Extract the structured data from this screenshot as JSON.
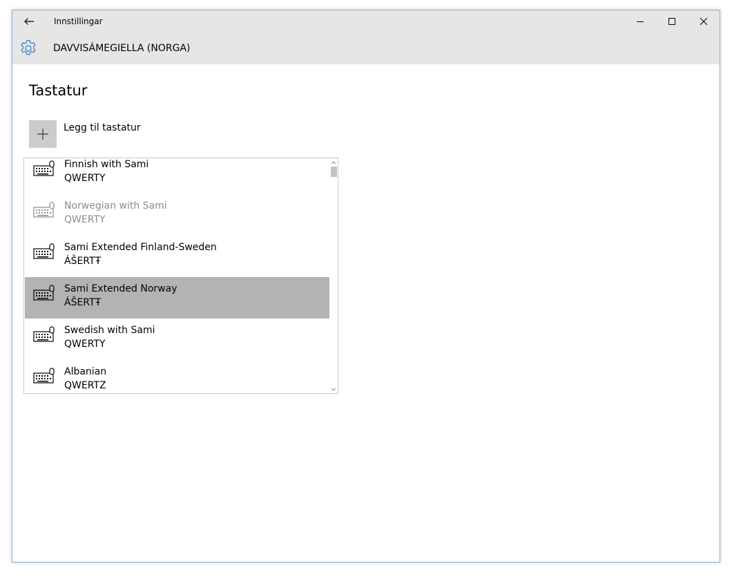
{
  "window": {
    "app_title": "Innstillingar",
    "controls": {
      "minimize_icon": "minimize-icon",
      "maximize_icon": "maximize-icon",
      "close_icon": "close-icon"
    }
  },
  "header": {
    "icon": "gear-icon",
    "title": "DAVVISÁMEGIELLA (NORGA)"
  },
  "page": {
    "title": "Tastatur",
    "add_keyboard_label": "Legg til tastatur"
  },
  "keyboards": [
    {
      "name": "Finnish with Sami",
      "layout": "QWERTY",
      "state": "normal"
    },
    {
      "name": "Norwegian with Sami",
      "layout": "QWERTY",
      "state": "dimmed"
    },
    {
      "name": "Sami Extended Finland-Sweden",
      "layout": "ÁŠERTŦ",
      "state": "normal"
    },
    {
      "name": "Sami Extended Norway",
      "layout": "ÁŠERTŦ",
      "state": "selected"
    },
    {
      "name": "Swedish with Sami",
      "layout": "QWERTY",
      "state": "normal"
    },
    {
      "name": "Albanian",
      "layout": "QWERTZ",
      "state": "normal"
    }
  ],
  "colors": {
    "titlebar_bg": "#e6e6e6",
    "accent": "#2f7fc8",
    "selected_bg": "#b3b3b3",
    "dim_text": "#8c8c8c"
  }
}
